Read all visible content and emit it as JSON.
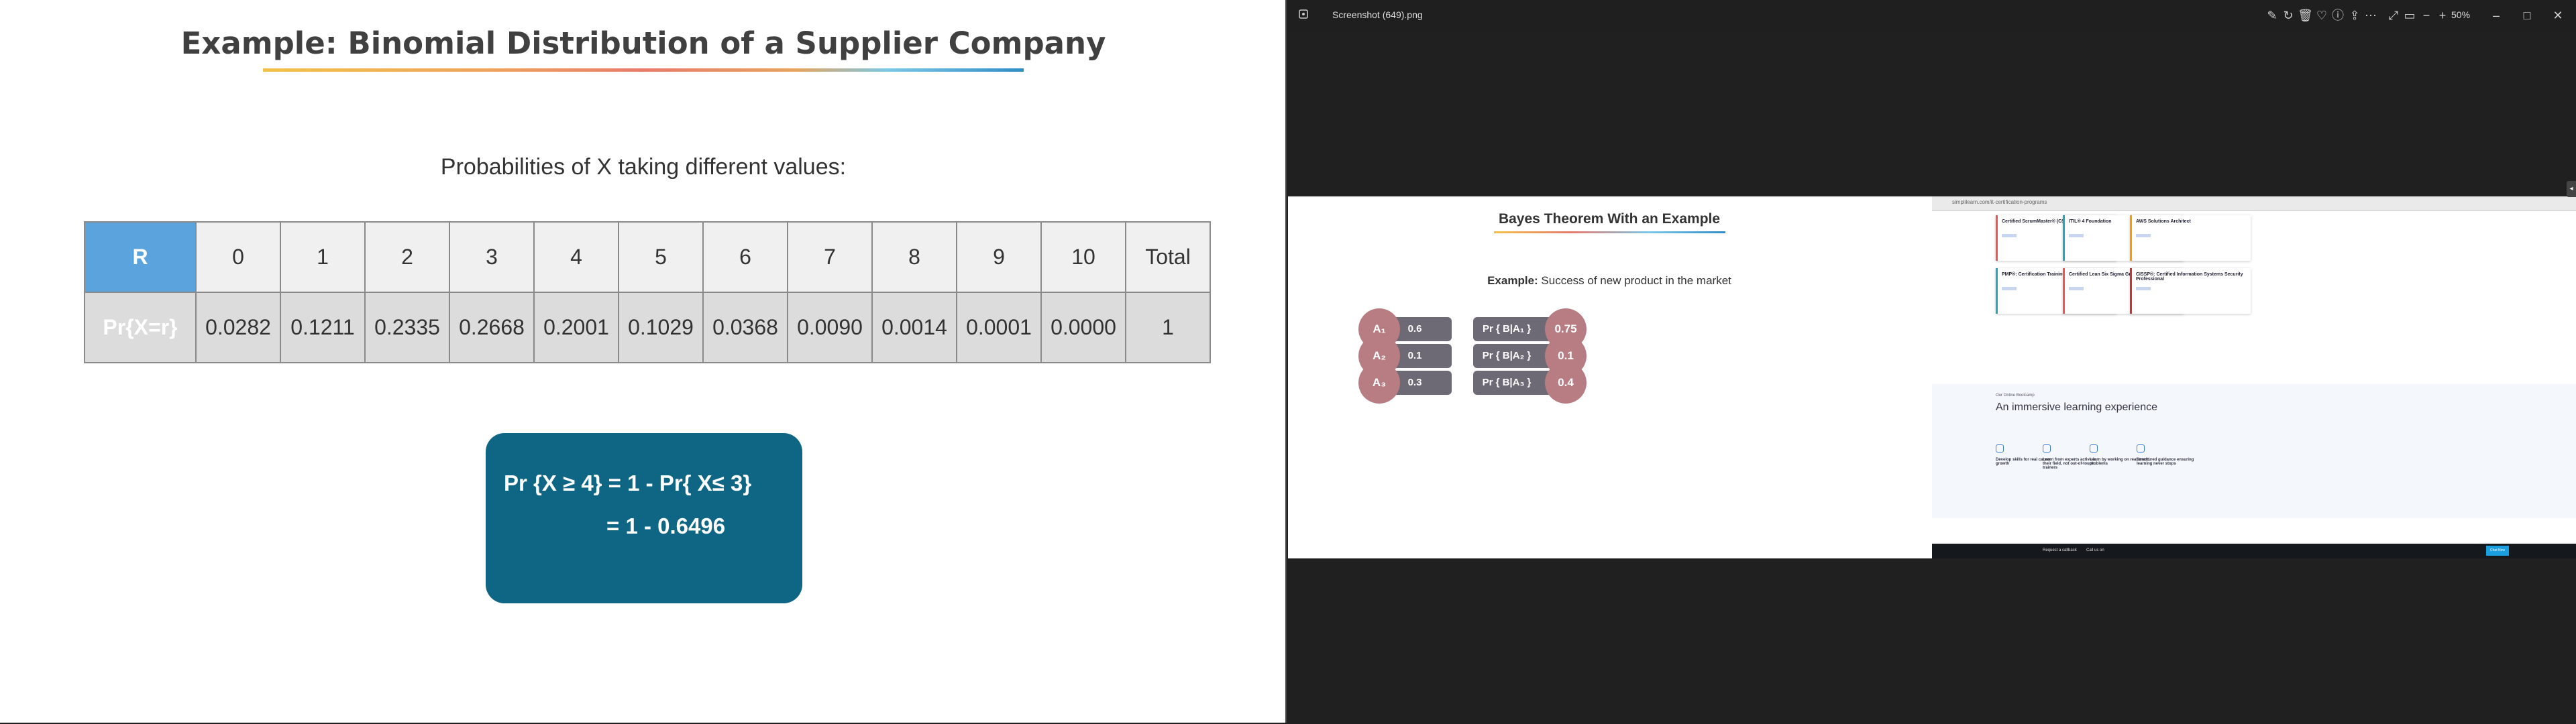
{
  "slide": {
    "title": "Example: Binomial Distribution of a Supplier Company",
    "subtitle": "Probabilities of X taking different values:",
    "table": {
      "row1_head": "R",
      "row2_head": "Pr{X=r}",
      "r_values": [
        "0",
        "1",
        "2",
        "3",
        "4",
        "5",
        "6",
        "7",
        "8",
        "9",
        "10",
        "Total"
      ],
      "p_values": [
        "0.0282",
        "0.1211",
        "0.2335",
        "0.2668",
        "0.2001",
        "0.1029",
        "0.0368",
        "0.0090",
        "0.0014",
        "0.0001",
        "0.0000",
        "1"
      ]
    },
    "formula": {
      "line1": "Pr {X ≥ 4} = 1 - Pr{ X≤ 3}",
      "line2": "= 1 - 0.6496"
    }
  },
  "viewer": {
    "file_name": "Screenshot (649).png",
    "zoom": "50%",
    "icons": [
      "open-folder-icon",
      "edit-icon",
      "rotate-icon",
      "delete-icon",
      "favorite-icon",
      "info-icon",
      "share-icon",
      "more-icon",
      "fullscreen-icon",
      "fit-icon",
      "zoom-out-icon",
      "zoom-in-icon",
      "minimize-icon",
      "maximize-icon",
      "close-icon"
    ],
    "bayes": {
      "title": "Bayes Theorem With an Example",
      "example_label": "Example:",
      "example_text": " Success of new product in the market",
      "left": [
        {
          "name": "A₁",
          "value": "0.6"
        },
        {
          "name": "A₂",
          "value": "0.1"
        },
        {
          "name": "A₃",
          "value": "0.3"
        }
      ],
      "right": [
        {
          "label": "Pr { B|A₁ }",
          "value": "0.75"
        },
        {
          "label": "Pr { B|A₂ }",
          "value": "0.1"
        },
        {
          "label": "Pr { B|A₃ }",
          "value": "0.4"
        }
      ]
    },
    "browser": {
      "url": "simplilearn.com/it-certification-programs",
      "courses": [
        "Certified ScrumMaster® (CSM)",
        "ITIL® 4 Foundation",
        "AWS Solutions Architect",
        "PMP®: Certification Training",
        "Certified Lean Six Sigma Green Belt",
        "CISSP®: Certified Information Systems Security Professional"
      ],
      "kicker": "Our Online Bootcamp",
      "headline": "An immersive learning experience",
      "features": [
        "Develop skills for real career growth",
        "Learn from experts active in their field, not out-of-touch trainers",
        "Learn by working on real-world problems",
        "Structured guidance ensuring learning never stops"
      ],
      "footer_callback": "Request a callback",
      "footer_call": "Call us on",
      "cta": "Chat Now"
    }
  }
}
